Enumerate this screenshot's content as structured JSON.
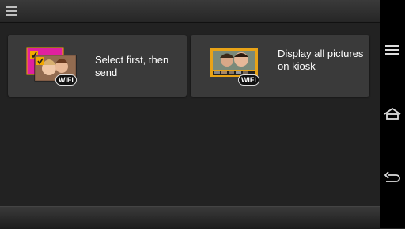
{
  "header": {
    "menu_icon": "hamburger-menu-icon"
  },
  "options": [
    {
      "label": "Select first, then send",
      "badge": "WiFi",
      "icon": "selected-photos-icon"
    },
    {
      "label": "Display all pictures on kiosk",
      "badge": "WiFi",
      "icon": "kiosk-display-icon"
    }
  ],
  "navbar": {
    "icons": [
      "recent-apps-icon",
      "home-icon",
      "back-icon"
    ]
  },
  "colors": {
    "background": "#222222",
    "card": "#3a3a3a",
    "check_accent": "#f2a900",
    "frame_accent": "#e8a317",
    "pink": "#e020a0"
  }
}
